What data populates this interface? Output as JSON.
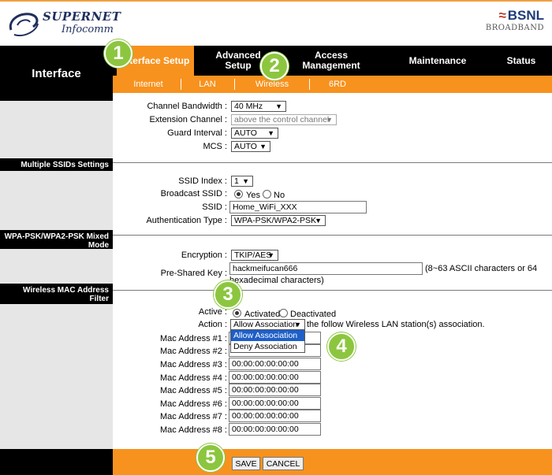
{
  "header": {
    "brand_name": "SUPERNET",
    "brand_sub": "Infocomm",
    "partner_name": "BSNL",
    "partner_sub": "BROADBAND"
  },
  "nav": {
    "title": "Interface",
    "tabs": [
      {
        "label": "Interface Setup",
        "active": true
      },
      {
        "label": "Advanced Setup",
        "active": false
      },
      {
        "label": "Access Management",
        "active": false
      },
      {
        "label": "Maintenance",
        "active": false
      },
      {
        "label": "Status",
        "active": false
      }
    ],
    "subtabs": [
      "Internet",
      "LAN",
      "Wireless",
      "6RD"
    ]
  },
  "wireless": {
    "channel_bandwidth": {
      "label": "Channel Bandwidth :",
      "value": "40 MHz"
    },
    "extension_channel": {
      "label": "Extension Channel :",
      "value": "above the control channel"
    },
    "guard_interval": {
      "label": "Guard Interval :",
      "value": "AUTO"
    },
    "mcs": {
      "label": "MCS :",
      "value": "AUTO"
    }
  },
  "ssid_section": {
    "title": "Multiple SSIDs Settings",
    "ssid_index": {
      "label": "SSID Index :",
      "value": "1"
    },
    "broadcast_ssid": {
      "label": "Broadcast SSID :",
      "yes": "Yes",
      "no": "No",
      "selected": "Yes"
    },
    "ssid": {
      "label": "SSID :",
      "value": "Home_WiFi_XXX"
    },
    "auth_type": {
      "label": "Authentication Type :",
      "value": "WPA-PSK/WPA2-PSK"
    }
  },
  "wpa_section": {
    "title": "WPA-PSK/WPA2-PSK Mixed Mode",
    "encryption": {
      "label": "Encryption :",
      "value": "TKIP/AES"
    },
    "psk": {
      "label": "Pre-Shared Key :",
      "value": "hackmeifucan666",
      "hint_1": "(8~63 ASCII characters or 64",
      "hint_2": "hexadecimal characters)"
    }
  },
  "mac_section": {
    "title": "Wireless MAC Address Filter",
    "active": {
      "label": "Active :",
      "activated": "Activated",
      "deactivated": "Deactivated",
      "selected": "Activated"
    },
    "action": {
      "label": "Action :",
      "value": "Allow Association",
      "suffix": "the follow Wireless LAN station(s) association.",
      "options": [
        "Allow Association",
        "Deny Association"
      ],
      "highlighted": "Allow Association"
    },
    "addresses": [
      {
        "label": "Mac Address #1 :",
        "value": ""
      },
      {
        "label": "Mac Address #2 :",
        "value": ""
      },
      {
        "label": "Mac Address #3 :",
        "value": "00:00:00:00:00:00"
      },
      {
        "label": "Mac Address #4 :",
        "value": "00:00:00:00:00:00"
      },
      {
        "label": "Mac Address #5 :",
        "value": "00:00:00:00:00:00"
      },
      {
        "label": "Mac Address #6 :",
        "value": "00:00:00:00:00:00"
      },
      {
        "label": "Mac Address #7 :",
        "value": "00:00:00:00:00:00"
      },
      {
        "label": "Mac Address #8 :",
        "value": "00:00:00:00:00:00"
      }
    ]
  },
  "footer": {
    "save": "SAVE",
    "cancel": "CANCEL"
  },
  "badges": [
    "1",
    "2",
    "3",
    "4",
    "5"
  ],
  "colors": {
    "accent": "#f7921e",
    "badge": "#8cc63f",
    "nav": "#000000"
  }
}
